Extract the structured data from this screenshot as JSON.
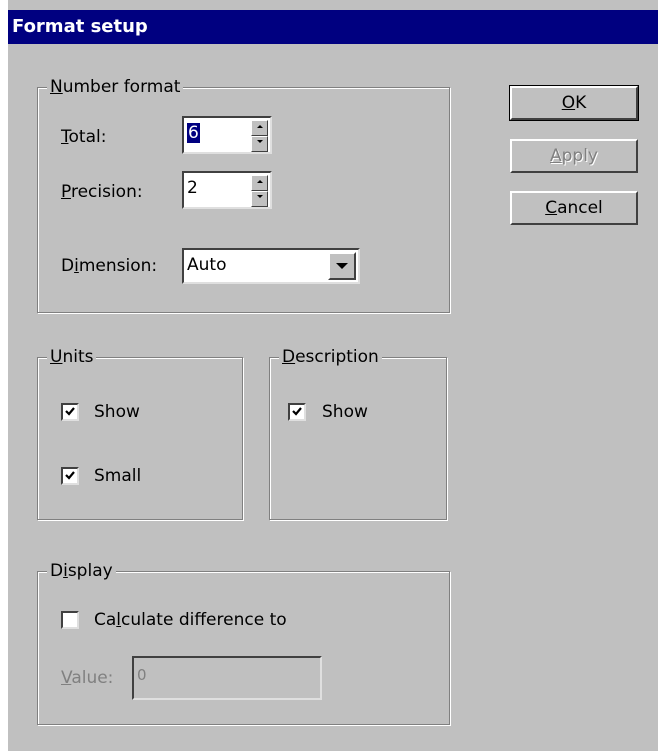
{
  "window": {
    "title": "Format setup"
  },
  "number_format": {
    "group_label_accel": "N",
    "group_label_rest": "umber format",
    "total_label_accel": "T",
    "total_label_rest": "otal:",
    "total_value": "6",
    "precision_label_accel": "P",
    "precision_label_rest": "recision:",
    "precision_value": "2",
    "dimension_label_pre": "D",
    "dimension_label_accel": "i",
    "dimension_label_rest": "mension:",
    "dimension_value": "Auto"
  },
  "units": {
    "group_label_accel": "U",
    "group_label_rest": "nits",
    "show_label": "Show",
    "show_checked": true,
    "small_label": "Small",
    "small_checked": true
  },
  "description": {
    "group_label_accel": "D",
    "group_label_rest": "escription",
    "show_label": "Show",
    "show_checked": true
  },
  "display": {
    "group_label_pre": "D",
    "group_label_accel": "i",
    "group_label_rest": "splay",
    "calc_label_pre": "Ca",
    "calc_label_accel": "l",
    "calc_label_rest": "culate difference to",
    "calc_checked": false,
    "value_label_accel": "V",
    "value_label_rest": "alue:",
    "value_value": "0"
  },
  "buttons": {
    "ok_accel": "O",
    "ok_rest": "K",
    "apply_accel": "A",
    "apply_rest": "pply",
    "cancel_accel": "C",
    "cancel_rest": "ancel"
  }
}
